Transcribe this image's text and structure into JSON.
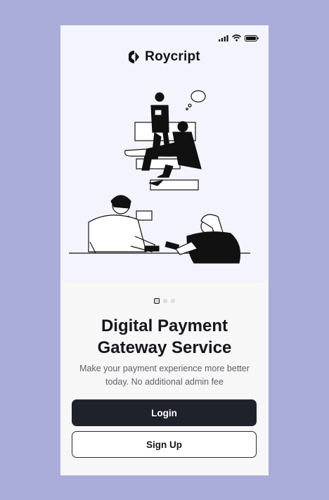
{
  "app": {
    "name": "Roycript"
  },
  "onboarding": {
    "title": "Digital Payment\nGateway Service",
    "subtitle": "Make your payment experience more better\ntoday. No additional admin fee",
    "page_indicator": {
      "total": 3,
      "active": 1
    }
  },
  "actions": {
    "login_label": "Login",
    "signup_label": "Sign Up"
  },
  "icons": [
    "cellular-signal-icon",
    "wifi-icon",
    "battery-icon",
    "roycript-logo-icon"
  ],
  "colors": {
    "background": "#aaadda",
    "hero": "#f4f4fe",
    "primary_button": "#1f222b",
    "text": "#15161b"
  }
}
